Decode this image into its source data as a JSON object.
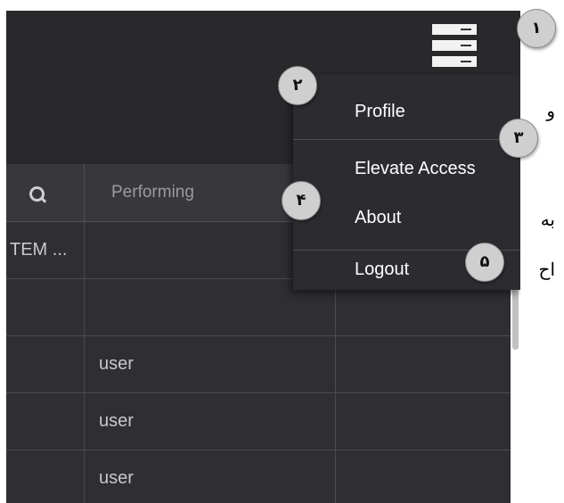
{
  "header": {
    "performing_label": "Performing"
  },
  "rows": [
    {
      "c0": "TEM ...",
      "c1": ""
    },
    {
      "c0": "",
      "c1": ""
    },
    {
      "c0": "",
      "c1": "user"
    },
    {
      "c0": "",
      "c1": "user"
    },
    {
      "c0": "",
      "c1": "user"
    }
  ],
  "dropdown": {
    "items": [
      {
        "label": "Profile"
      },
      {
        "label": "Elevate Access"
      },
      {
        "label": "About"
      },
      {
        "label": "Logout"
      }
    ]
  },
  "badges": [
    "۱",
    "۲",
    "۳",
    "۴",
    "۵"
  ],
  "side_text": [
    "و",
    "به",
    "اح"
  ],
  "icons": {
    "menu": "hamburger-menu-icon",
    "search": "search-icon"
  }
}
